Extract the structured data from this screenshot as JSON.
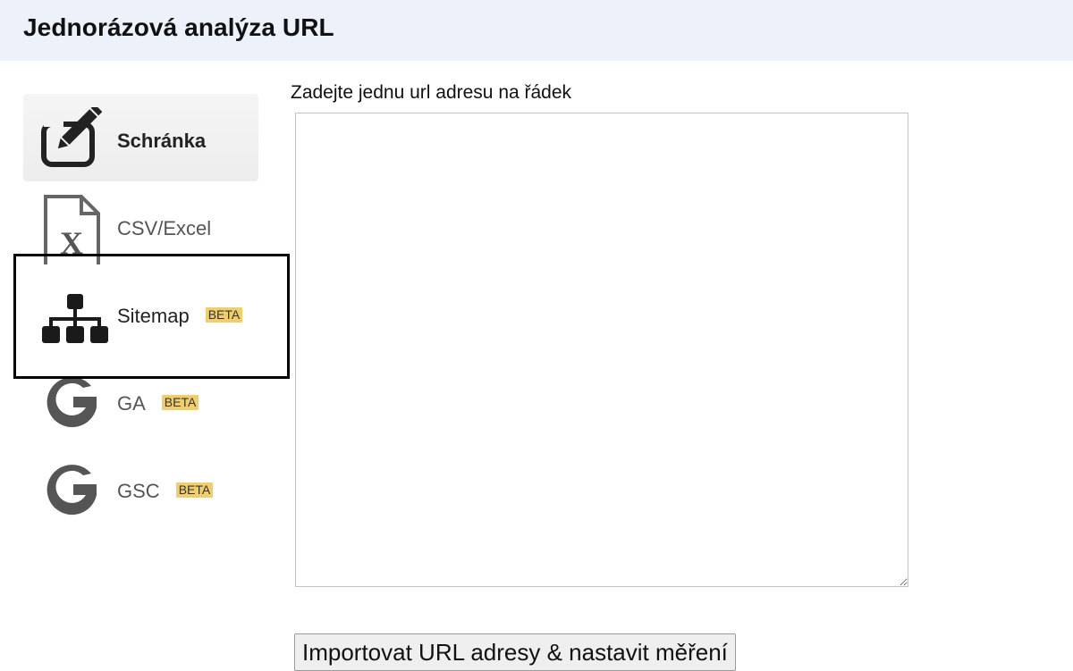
{
  "header": {
    "title": "Jednorázová analýza URL"
  },
  "sidebar": {
    "items": [
      {
        "label": "Schránka",
        "icon": "edit-icon",
        "active": true,
        "beta": ""
      },
      {
        "label": "CSV/Excel",
        "icon": "excel-file-icon",
        "active": false,
        "beta": ""
      },
      {
        "label": "Sitemap",
        "icon": "sitemap-icon",
        "active": false,
        "beta": "BETA"
      },
      {
        "label": "GA",
        "icon": "google-icon",
        "active": false,
        "beta": "BETA"
      },
      {
        "label": "GSC",
        "icon": "google-icon",
        "active": false,
        "beta": "BETA"
      }
    ]
  },
  "main": {
    "field_label": "Zadejte jednu url adresu na řádek",
    "textarea_value": "",
    "import_button_label": "Importovat URL adresy & nastavit měření"
  },
  "colors": {
    "header_bg": "#edf2fa",
    "beta_badge": "#f0cf6a",
    "active_item_bg": "#f0f0f0",
    "icon_dark": "#222222",
    "icon_grey": "#555555"
  }
}
